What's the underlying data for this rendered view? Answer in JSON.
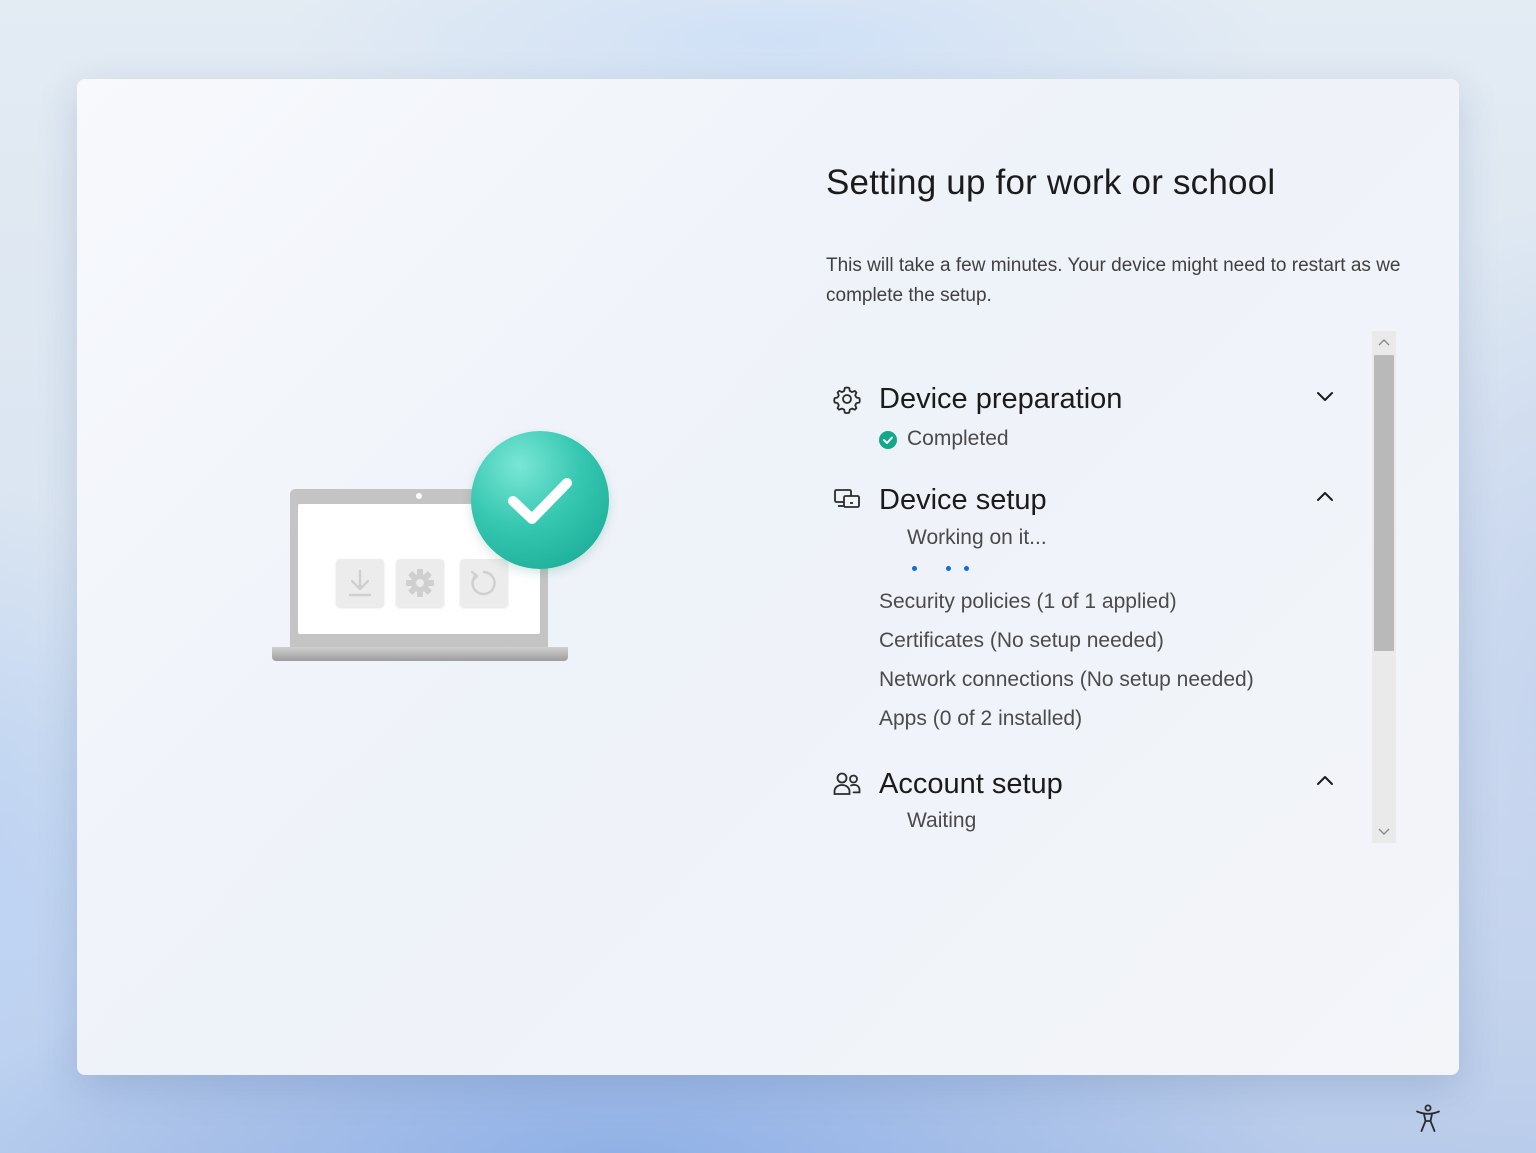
{
  "page": {
    "title": "Setting up for work or school",
    "description": "This will take a few minutes. Your device might need to restart as we complete the setup."
  },
  "illustration": {
    "icons": [
      "download-icon",
      "gear-icon",
      "refresh-icon",
      "checkmark-icon"
    ],
    "badge_color": "#1fb9a0"
  },
  "sections": {
    "device_preparation": {
      "title": "Device preparation",
      "status": "Completed",
      "icon": "gear-icon",
      "expanded": false
    },
    "device_setup": {
      "title": "Device setup",
      "status": "Working on it...",
      "icon": "device-setup-icon",
      "expanded": true,
      "items": [
        "Security policies (1 of 1 applied)",
        "Certificates (No setup needed)",
        "Network connections (No setup needed)",
        "Apps (0 of 2 installed)"
      ]
    },
    "account_setup": {
      "title": "Account setup",
      "status": "Waiting",
      "icon": "people-icon",
      "expanded": true
    }
  },
  "colors": {
    "accent": "#0f6fd6",
    "success": "#12a889"
  },
  "accessibility": {
    "icon": "accessibility-icon"
  }
}
